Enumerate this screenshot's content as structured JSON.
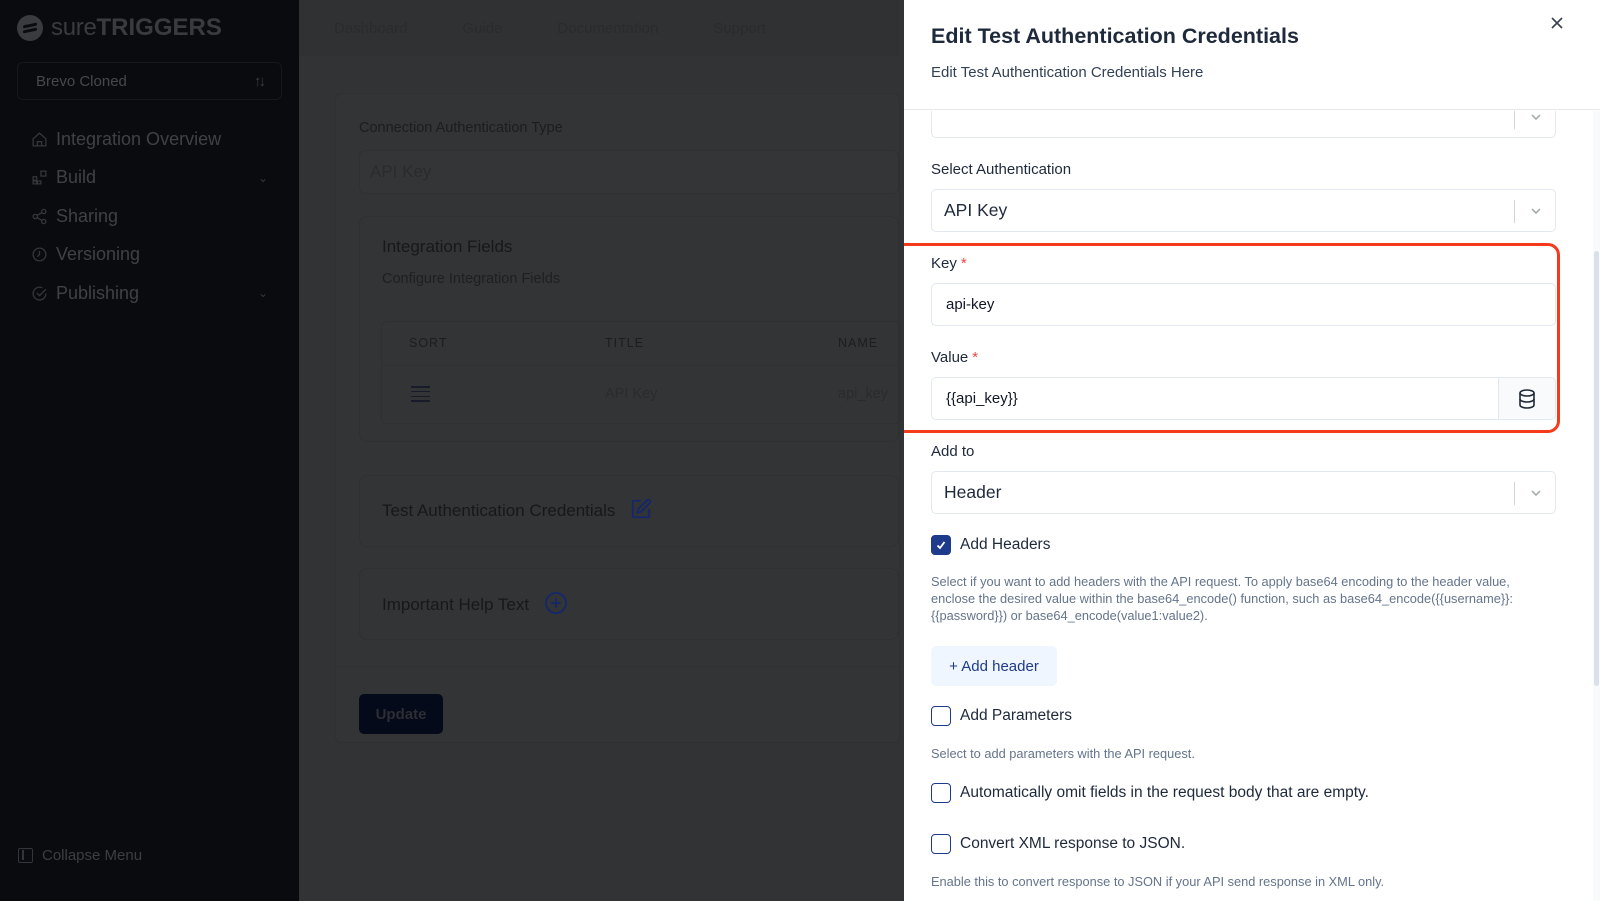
{
  "sidebar": {
    "logo": {
      "light": "sure",
      "bold": "TRIGGERS"
    },
    "project": "Brevo Cloned",
    "items": [
      {
        "label": "Integration Overview",
        "icon": "home-icon",
        "has_chevron": false
      },
      {
        "label": "Build",
        "icon": "blocks-icon",
        "has_chevron": true
      },
      {
        "label": "Sharing",
        "icon": "share-icon",
        "has_chevron": false
      },
      {
        "label": "Versioning",
        "icon": "clock-icon",
        "has_chevron": false
      },
      {
        "label": "Publishing",
        "icon": "check-circle-icon",
        "has_chevron": true
      }
    ],
    "collapse_label": "Collapse Menu"
  },
  "topnav": {
    "items": [
      "Dashboard",
      "Guide",
      "Documentation",
      "Support"
    ]
  },
  "main": {
    "connection_label": "Connection Authentication Type",
    "connection_value": "API Key",
    "integration_fields": {
      "title": "Integration Fields",
      "subtitle": "Configure Integration Fields",
      "columns": [
        "SORT",
        "TITLE",
        "NAME"
      ],
      "rows": [
        {
          "title": "API Key",
          "name": "api_key"
        }
      ]
    },
    "test_credentials_title": "Test Authentication Credentials",
    "help_text_title": "Important Help Text",
    "update_label": "Update"
  },
  "drawer": {
    "title": "Edit Test Authentication Credentials",
    "subtitle": "Edit Test Authentication Credentials Here",
    "top_select_value": "",
    "select_auth_label": "Select Authentication",
    "select_auth_value": "API Key",
    "key_label": "Key",
    "key_value": "api-key",
    "value_label": "Value",
    "value_value": "{{api_key}}",
    "required_mark": "*",
    "add_to_label": "Add to",
    "add_to_value": "Header",
    "add_headers": {
      "label": "Add Headers",
      "checked": true
    },
    "add_headers_help": "Select if you want to add headers with the API request. To apply base64 encoding to the header value, enclose the desired value within the base64_encode() function, such as base64_encode({{username}}:{{password}}) or base64_encode(value1:value2).",
    "add_header_button": "+ Add header",
    "add_parameters": {
      "label": "Add Parameters",
      "checked": false
    },
    "add_parameters_help": "Select to add parameters with the API request.",
    "omit_empty": {
      "label": "Automatically omit fields in the request body that are empty.",
      "checked": false
    },
    "convert_xml": {
      "label": "Convert XML response to JSON.",
      "checked": false
    },
    "convert_xml_help": "Enable this to convert response to JSON if your API send response in XML only.",
    "highlight_color": "#f53b1c",
    "accent_color": "#1e3a8a"
  }
}
